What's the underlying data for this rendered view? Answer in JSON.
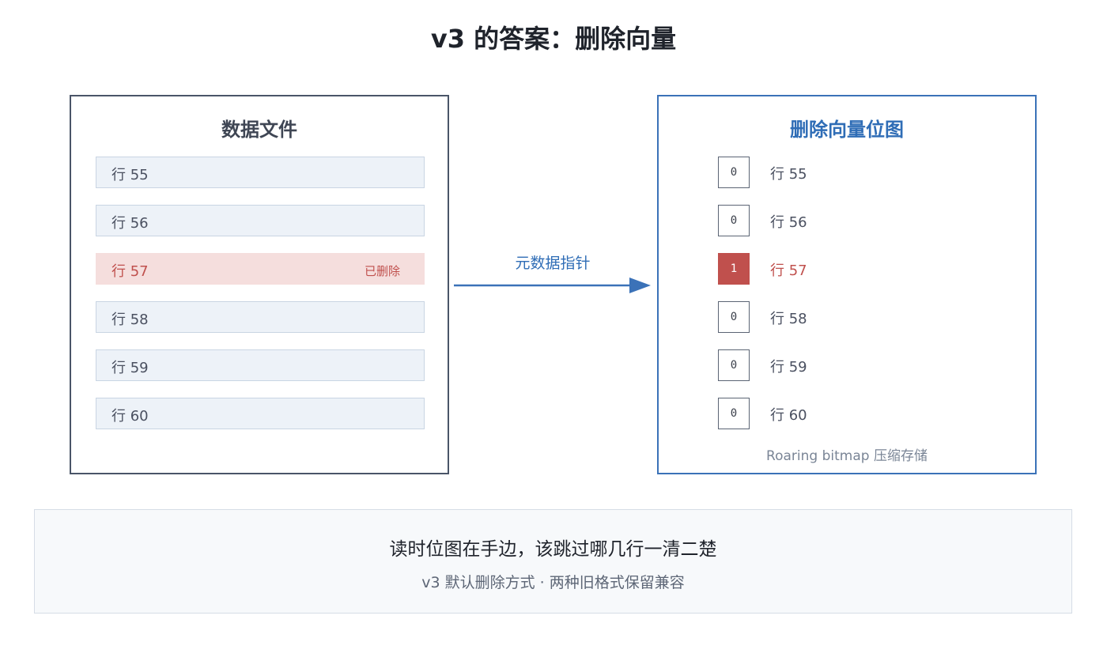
{
  "title": "v3 的答案：删除向量",
  "data_file": {
    "title": "数据文件",
    "rows": [
      {
        "label": "行 55",
        "tag": "",
        "deleted": false
      },
      {
        "label": "行 56",
        "tag": "",
        "deleted": false
      },
      {
        "label": "行 57",
        "tag": "已删除",
        "deleted": true
      },
      {
        "label": "行 58",
        "tag": "",
        "deleted": false
      },
      {
        "label": "行 59",
        "tag": "",
        "deleted": false
      },
      {
        "label": "行 60",
        "tag": "",
        "deleted": false
      }
    ]
  },
  "arrow": {
    "label": "元数据指针",
    "color": "#2f6db6"
  },
  "bitmap": {
    "title": "删除向量位图",
    "entries": [
      {
        "bit": "0",
        "label": "行 55",
        "set": false
      },
      {
        "bit": "0",
        "label": "行 56",
        "set": false
      },
      {
        "bit": "1",
        "label": "行 57",
        "set": true
      },
      {
        "bit": "0",
        "label": "行 58",
        "set": false
      },
      {
        "bit": "0",
        "label": "行 59",
        "set": false
      },
      {
        "bit": "0",
        "label": "行 60",
        "set": false
      }
    ],
    "note": "Roaring bitmap 压缩存储"
  },
  "footer": {
    "main": "读时位图在手边，该跳过哪几行一清二楚",
    "sub": "v3 默认删除方式 · 两种旧格式保留兼容"
  },
  "colors": {
    "deleted": "#c0504d",
    "accent": "#2f6db6",
    "neutral_border": "#4a5568"
  }
}
